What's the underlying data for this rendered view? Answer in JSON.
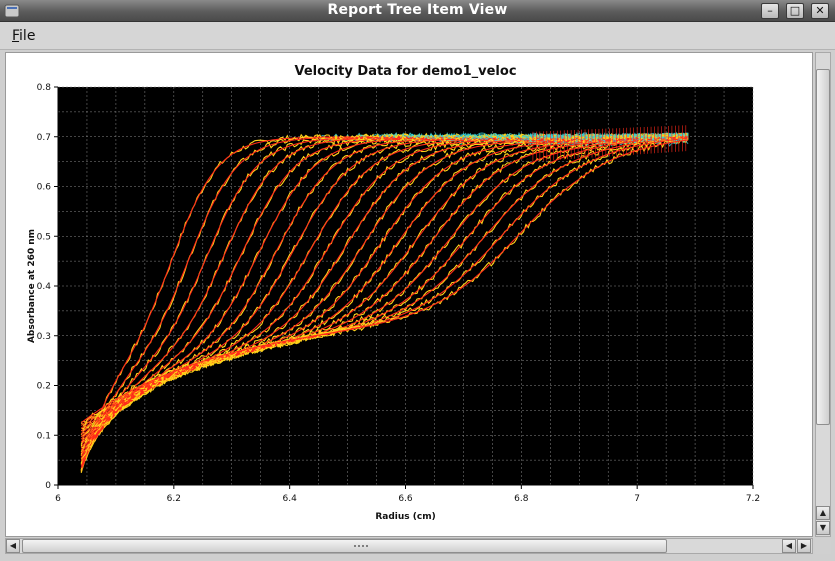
{
  "window": {
    "title": "Report Tree Item View"
  },
  "menu": {
    "file_mnemonic": "F",
    "file_rest": "ile"
  },
  "chart_data": {
    "type": "line",
    "title": "Velocity Data for demo1_veloc",
    "xlabel": "Radius (cm)",
    "ylabel": "Absorbance at 260 nm",
    "xlim": [
      6.0,
      7.2
    ],
    "ylim": [
      0.0,
      0.8
    ],
    "xticks": [
      "6",
      "6.2",
      "6.4",
      "6.6",
      "6.8",
      "7",
      "7.2"
    ],
    "yticks": [
      "0",
      "0.1",
      "0.2",
      "0.3",
      "0.4",
      "0.5",
      "0.6",
      "0.7",
      "0.8"
    ],
    "grid": true,
    "background": "#000000",
    "colors": {
      "fit": "#ff2a1a",
      "data": "#ffd21a",
      "plateau_data": "#34d0d8"
    },
    "meniscus_radius": 6.04,
    "bottom_radius": 7.09,
    "plateau": [
      0.695,
      0.71
    ],
    "series": [
      {
        "boundary_midpoint": 6.2,
        "plateau": 0.7
      },
      {
        "boundary_midpoint": 6.23,
        "plateau": 0.7
      },
      {
        "boundary_midpoint": 6.26,
        "plateau": 0.699
      },
      {
        "boundary_midpoint": 6.29,
        "plateau": 0.699
      },
      {
        "boundary_midpoint": 6.32,
        "plateau": 0.698
      },
      {
        "boundary_midpoint": 6.35,
        "plateau": 0.698
      },
      {
        "boundary_midpoint": 6.38,
        "plateau": 0.697
      },
      {
        "boundary_midpoint": 6.41,
        "plateau": 0.697
      },
      {
        "boundary_midpoint": 6.44,
        "plateau": 0.696
      },
      {
        "boundary_midpoint": 6.47,
        "plateau": 0.696
      },
      {
        "boundary_midpoint": 6.5,
        "plateau": 0.695
      },
      {
        "boundary_midpoint": 6.53,
        "plateau": 0.695
      },
      {
        "boundary_midpoint": 6.56,
        "plateau": 0.694
      },
      {
        "boundary_midpoint": 6.59,
        "plateau": 0.694
      },
      {
        "boundary_midpoint": 6.62,
        "plateau": 0.693
      },
      {
        "boundary_midpoint": 6.65,
        "plateau": 0.693
      },
      {
        "boundary_midpoint": 6.68,
        "plateau": 0.692
      },
      {
        "boundary_midpoint": 6.71,
        "plateau": 0.692
      },
      {
        "boundary_midpoint": 6.74,
        "plateau": 0.691
      },
      {
        "boundary_midpoint": 6.77,
        "plateau": 0.691
      },
      {
        "boundary_midpoint": 6.8,
        "plateau": 0.69
      }
    ]
  }
}
